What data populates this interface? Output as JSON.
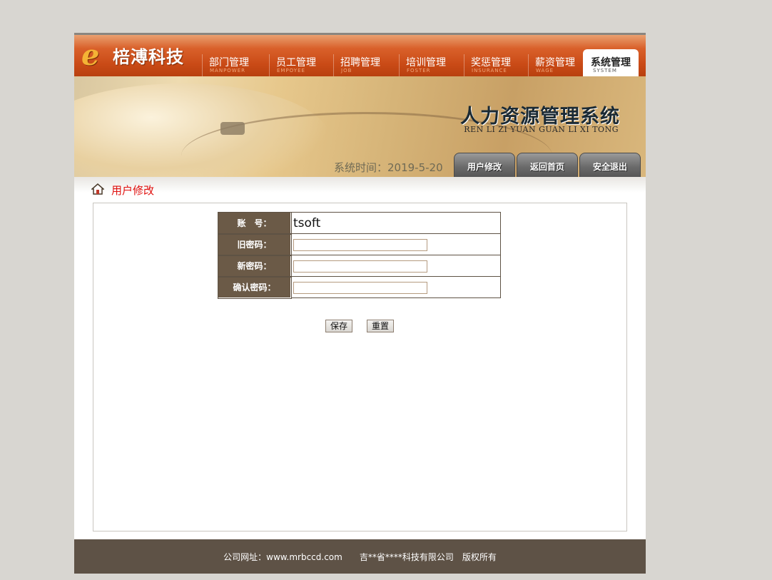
{
  "header": {
    "logo_mark": "e",
    "company_name": "棓溥科技",
    "nav": [
      {
        "zh": "部门管理",
        "en": "MANPOWER"
      },
      {
        "zh": "员工管理",
        "en": "EMPOYEE"
      },
      {
        "zh": "招聘管理",
        "en": "JOB"
      },
      {
        "zh": "培训管理",
        "en": "FOSTER"
      },
      {
        "zh": "奖惩管理",
        "en": "INSURANCE"
      },
      {
        "zh": "薪资管理",
        "en": "WAGE"
      },
      {
        "zh": "系统管理",
        "en": "SYSTEM",
        "active": true
      }
    ]
  },
  "banner": {
    "title": "人力资源管理系统",
    "subtitle": "REN LI ZI YUAN GUAN LI XI TONG",
    "system_time": "系统时间：2019-5-20",
    "tabs": [
      "用户修改",
      "返回首页",
      "安全退出"
    ]
  },
  "breadcrumb": {
    "icon": "home-icon",
    "label": "用户修改"
  },
  "form": {
    "account_label": "账　号：",
    "account_value": "tsoft",
    "old_password_label": "旧密码：",
    "new_password_label": "新密码：",
    "confirm_password_label": "确认密码：",
    "old_password_value": "",
    "new_password_value": "",
    "confirm_password_value": "",
    "save_label": "保存",
    "reset_label": "重置"
  },
  "footer": {
    "text": "公司网址：www.mrbccd.com　　吉**省****科技有限公司　版权所有"
  },
  "colors": {
    "nav_bar": "#c94a16",
    "label_cell": "#6b5a47",
    "footer": "#5e5246",
    "breadcrumb_text": "#e0100e"
  }
}
